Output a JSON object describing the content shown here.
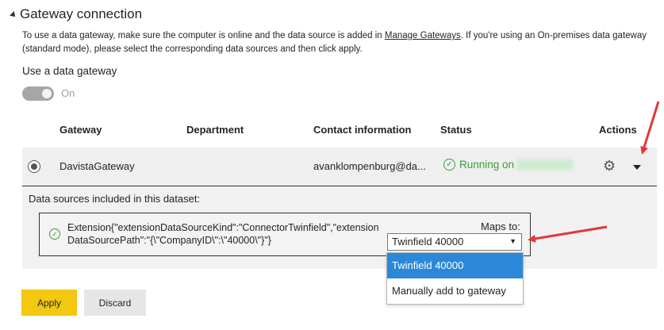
{
  "section": {
    "title": "Gateway connection"
  },
  "description": {
    "before_link": "To use a data gateway, make sure the computer is online and the data source is added in ",
    "link": "Manage Gateways",
    "after_link": ". If you're using an On-premises data gateway (standard mode), please select the corresponding data sources and then click apply."
  },
  "use_gateway": {
    "label": "Use a data gateway",
    "toggle_state": "On"
  },
  "table": {
    "headers": {
      "gateway": "Gateway",
      "department": "Department",
      "contact": "Contact information",
      "status": "Status",
      "actions": "Actions"
    },
    "row": {
      "gateway": "DavistaGateway",
      "department": "",
      "contact": "avanklompenburg@da...",
      "status": "Running on"
    }
  },
  "datasources": {
    "label": "Data sources included in this dataset:",
    "source_text": "Extension{\"extensionDataSourceKind\":\"ConnectorTwinfield\",\"extensionDataSourcePath\":\"{\\\"CompanyID\\\":\\\"40000\\\"}\"}",
    "maps_to_label": "Maps to:",
    "selected": "Twinfield 40000",
    "options": [
      "Twinfield 40000",
      "Manually add to gateway"
    ]
  },
  "buttons": {
    "apply": "Apply",
    "discard": "Discard"
  },
  "colors": {
    "accent_yellow": "#f2c811",
    "status_green": "#3a9d3a",
    "selection_blue": "#2b88d8",
    "annotation_red": "#e03a3a"
  }
}
